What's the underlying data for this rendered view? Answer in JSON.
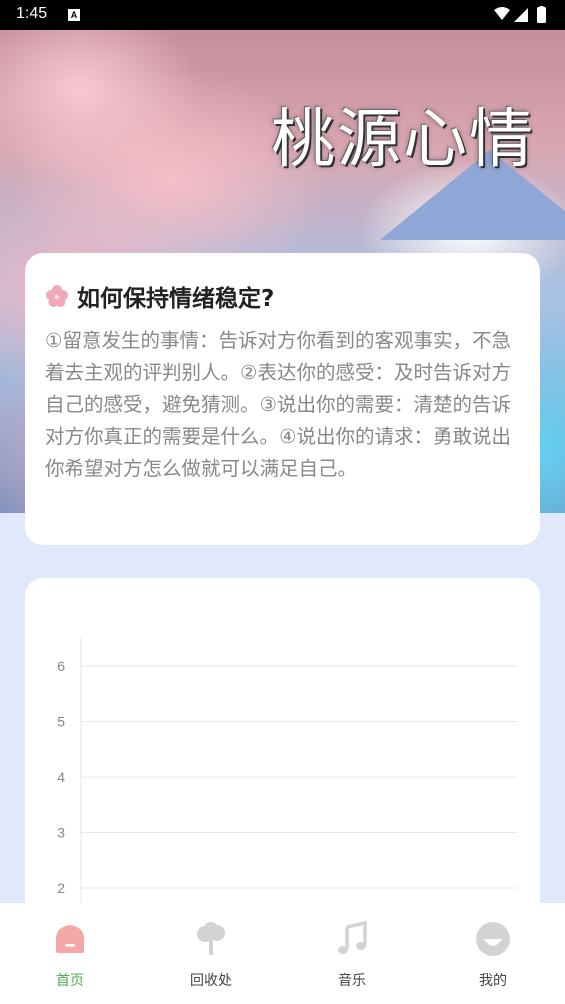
{
  "status_bar": {
    "time": "1:45"
  },
  "hero": {
    "title": "桃源心情"
  },
  "question_card": {
    "icon": "flower-icon",
    "title": "如何保持情绪稳定?",
    "body": "①留意发生的事情：告诉对方你看到的客观事实，不急着去主观的评判别人。②表达你的感受：及时告诉对方自己的感受，避免猜测。③说出你的需要：清楚的告诉对方你真正的需要是什么。④说出你的请求：勇敢说出你希望对方怎么做就可以满足自己。"
  },
  "chart_data": {
    "type": "line",
    "y_ticks": [
      "2",
      "3",
      "4",
      "5",
      "6"
    ],
    "ylim": [
      2,
      6
    ],
    "grid": true,
    "series": []
  },
  "tabbar": {
    "tabs": [
      {
        "label": "首页",
        "icon": "home-icon",
        "active": true
      },
      {
        "label": "回收处",
        "icon": "tree-icon",
        "active": false
      },
      {
        "label": "音乐",
        "icon": "music-note-icon",
        "active": false
      },
      {
        "label": "我的",
        "icon": "profile-icon",
        "active": false
      }
    ]
  },
  "colors": {
    "accent_green": "#4caf50",
    "home_icon": "#f4a7a7",
    "inactive_icon": "#d3d3d3"
  }
}
